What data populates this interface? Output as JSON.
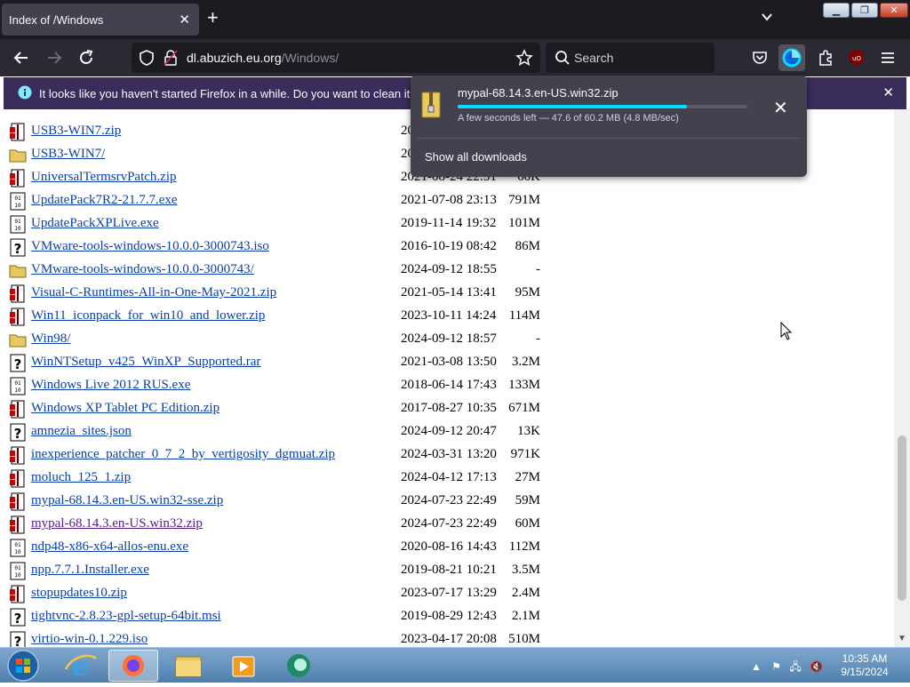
{
  "tab": {
    "title": "Index of /Windows"
  },
  "nav": {
    "url_host": "dl.abuzich.eu.org",
    "url_path": "/Windows/",
    "search_placeholder": "Search"
  },
  "notification": {
    "text": "It looks like you haven't started Firefox in a while. Do you want to clean it up for"
  },
  "download": {
    "filename": "mypal-68.14.3.en-US.win32.zip",
    "progress": 0.79,
    "status": "A few seconds left — 47.6 of 60.2 MB (4.8 MB/sec)",
    "show_all": "Show all downloads",
    "accent": "#00ddff"
  },
  "listing": {
    "rows": [
      {
        "name": "USB3-WIN7.zip",
        "date": "20",
        "size": "",
        "icon": "archive"
      },
      {
        "name": "USB3-WIN7/",
        "date": "20",
        "size": "",
        "icon": "folder"
      },
      {
        "name": "UniversalTermsrvPatch.zip",
        "date": "2021-08-24 22:51",
        "size": "60K",
        "icon": "archive"
      },
      {
        "name": "UpdatePack7R2-21.7.7.exe",
        "date": "2021-07-08 23:13",
        "size": "791M",
        "icon": "binary"
      },
      {
        "name": "UpdatePackXPLive.exe",
        "date": "2019-11-14 19:32",
        "size": "101M",
        "icon": "binary"
      },
      {
        "name": "VMware-tools-windows-10.0.0-3000743.iso",
        "date": "2016-10-19 08:42",
        "size": "86M",
        "icon": "unknown"
      },
      {
        "name": "VMware-tools-windows-10.0.0-3000743/",
        "date": "2024-09-12 18:55",
        "size": "-",
        "icon": "folder"
      },
      {
        "name": "Visual-C-Runtimes-All-in-One-May-2021.zip",
        "date": "2021-05-14 13:41",
        "size": "95M",
        "icon": "archive"
      },
      {
        "name": "Win11_iconpack_for_win10_and_lower.zip",
        "date": "2023-10-11 14:24",
        "size": "114M",
        "icon": "archive"
      },
      {
        "name": "Win98/",
        "date": "2024-09-12 18:57",
        "size": "-",
        "icon": "folder"
      },
      {
        "name": "WinNTSetup_v425_WinXP_Supported.rar",
        "date": "2021-03-08 13:50",
        "size": "3.2M",
        "icon": "unknown"
      },
      {
        "name": "Windows Live 2012 RUS.exe",
        "date": "2018-06-14 17:43",
        "size": "133M",
        "icon": "binary"
      },
      {
        "name": "Windows XP Tablet PC Edition.zip",
        "date": "2017-08-27 10:35",
        "size": "671M",
        "icon": "archive"
      },
      {
        "name": "amnezia_sites.json",
        "date": "2024-09-12 20:47",
        "size": "13K",
        "icon": "unknown"
      },
      {
        "name": "inexperience_patcher_0_7_2_by_vertigosity_dgmuat.zip",
        "date": "2024-03-31 13:20",
        "size": "971K",
        "icon": "archive"
      },
      {
        "name": "moluch_125_1.zip",
        "date": "2024-04-12 17:13",
        "size": "27M",
        "icon": "archive"
      },
      {
        "name": "mypal-68.14.3.en-US.win32-sse.zip",
        "date": "2024-07-23 22:49",
        "size": "59M",
        "icon": "archive"
      },
      {
        "name": "mypal-68.14.3.en-US.win32.zip",
        "date": "2024-07-23 22:49",
        "size": "60M",
        "icon": "archive",
        "visited": true
      },
      {
        "name": "ndp48-x86-x64-allos-enu.exe",
        "date": "2020-08-16 14:43",
        "size": "112M",
        "icon": "binary"
      },
      {
        "name": "npp.7.7.1.Installer.exe",
        "date": "2019-08-21 10:21",
        "size": "3.5M",
        "icon": "binary"
      },
      {
        "name": "stopupdates10.zip",
        "date": "2023-07-17 13:29",
        "size": "2.4M",
        "icon": "archive"
      },
      {
        "name": "tightvnc-2.8.23-gpl-setup-64bit.msi",
        "date": "2019-08-29 12:43",
        "size": "2.1M",
        "icon": "unknown"
      },
      {
        "name": "virtio-win-0.1.229.iso",
        "date": "2023-04-17 20:08",
        "size": "510M",
        "icon": "unknown"
      }
    ]
  },
  "taskbar": {
    "time": "10:35 AM",
    "date": "9/15/2024"
  }
}
